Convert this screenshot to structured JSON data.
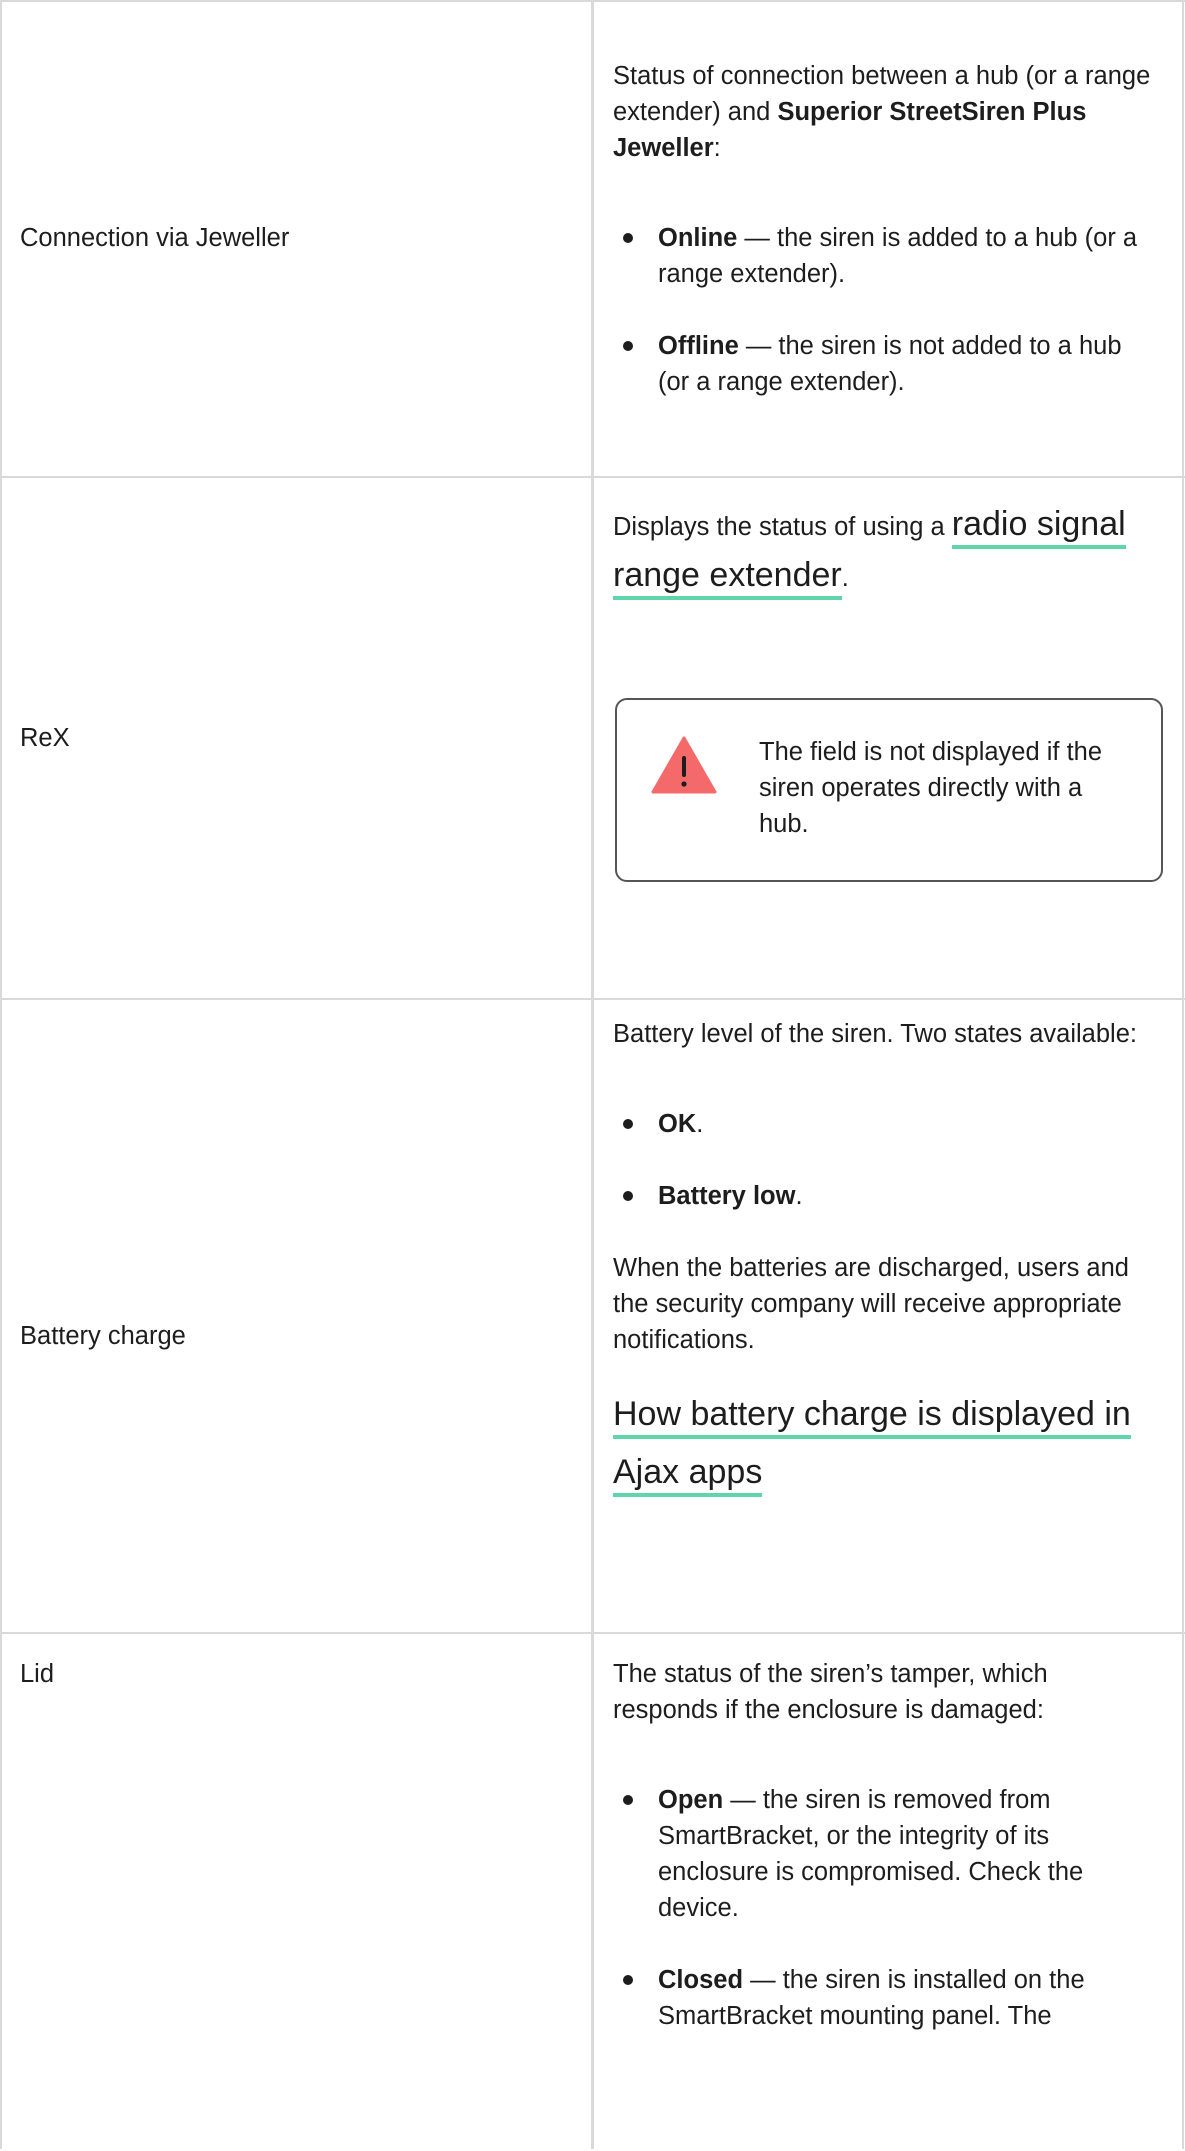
{
  "rows": [
    {
      "name": "Connection via Jeweller",
      "intro_pre": "Status of connection between a hub (or a range extender) and ",
      "intro_bold": "Superior StreetSiren Plus Jeweller",
      "intro_post": ":",
      "items": [
        {
          "bold": "Online",
          "text": " — the siren is added to a hub (or a range extender)."
        },
        {
          "bold": "Offline",
          "text": " — the siren is not added to a hub (or a range extender)."
        }
      ]
    },
    {
      "name": "ReX",
      "intro_pre": "Displays the status of using a ",
      "link": "radio signal range extender",
      "intro_post": ".",
      "warning_text": "The field is not displayed if the siren operates directly with a hub.",
      "warning_icon": "warning-triangle-icon",
      "warning_color": "#f46a6a"
    },
    {
      "name": "Battery charge",
      "intro": "Battery level of the siren. Two states available:",
      "items": [
        {
          "bold": "OK",
          "text": "."
        },
        {
          "bold": "Battery low",
          "text": "."
        }
      ],
      "note": "When the batteries are discharged, users and the security company will receive appropriate notifications.",
      "link": "How battery charge is displayed in Ajax apps"
    },
    {
      "name": "Lid",
      "intro": "The status of the siren’s tamper, which responds if the enclosure is damaged:",
      "items": [
        {
          "bold": "Open",
          "text": " — the siren is removed from SmartBracket, or the integrity of its enclosure is compromised. Check the device."
        },
        {
          "bold": "Closed",
          "text": " — the siren is installed on the SmartBracket mounting panel. The"
        }
      ]
    }
  ],
  "colors": {
    "link_underline": "#5fd6a9",
    "border": "#d9d9d9"
  }
}
